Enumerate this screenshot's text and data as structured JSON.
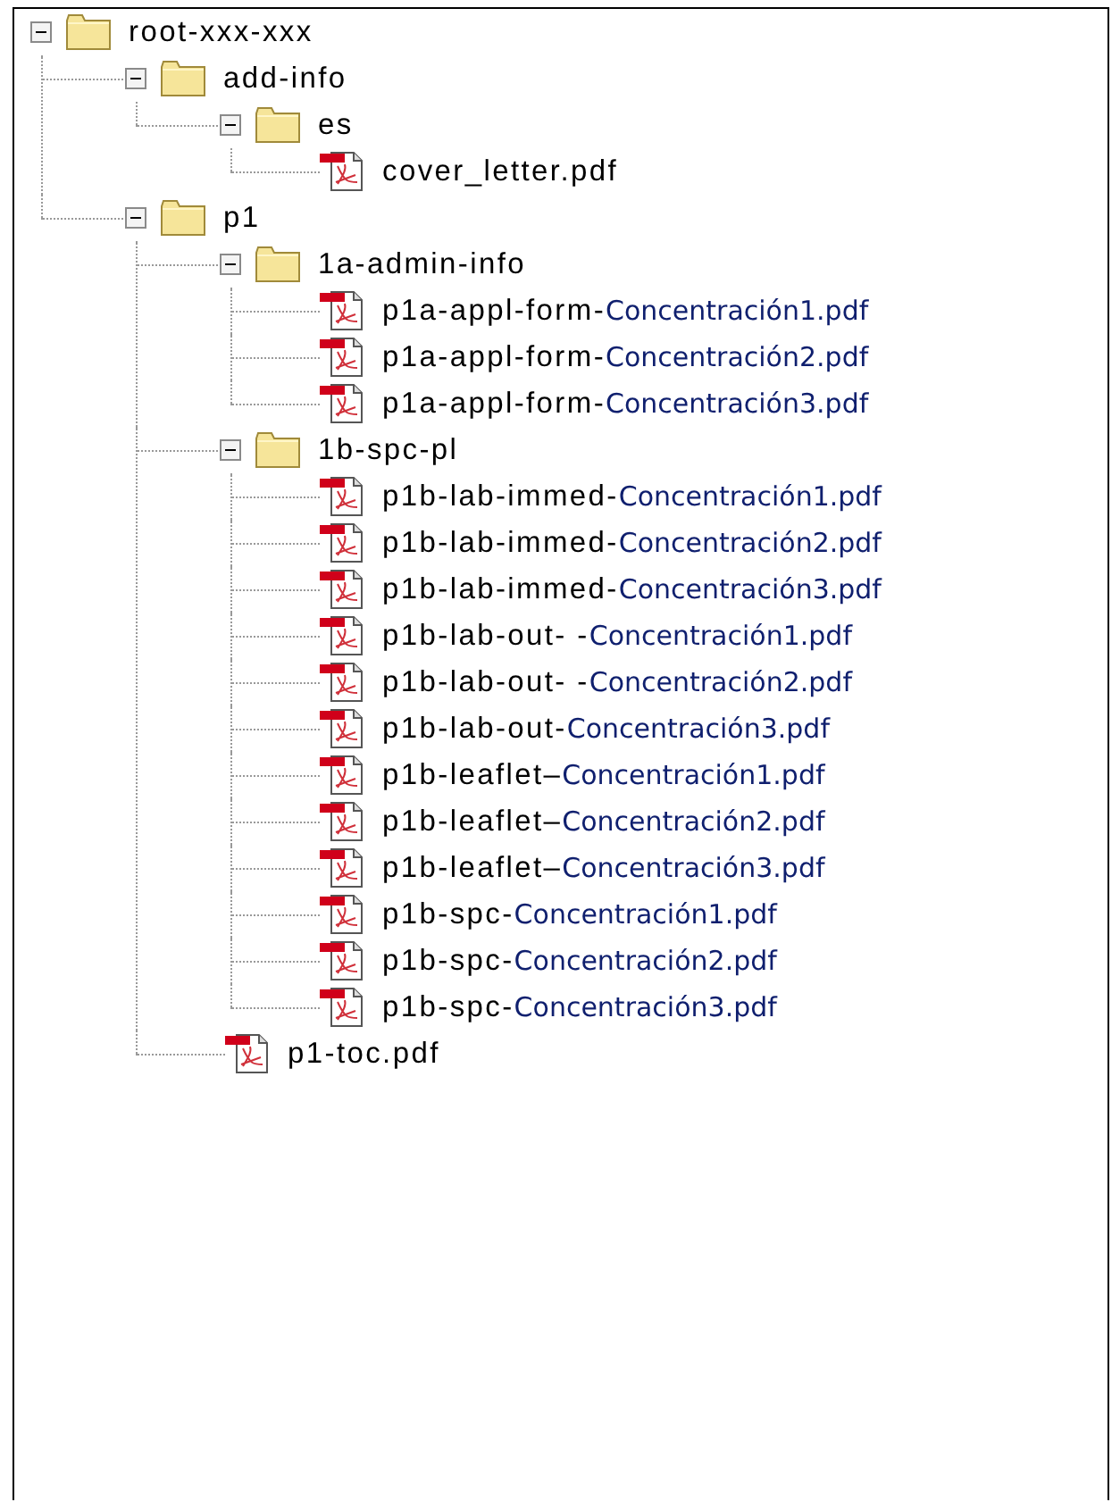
{
  "tree": [
    {
      "kind": "folder",
      "label": "root-xxx-xxx",
      "expanded": true,
      "children": [
        {
          "kind": "folder",
          "label": "add-info",
          "expanded": true,
          "children": [
            {
              "kind": "folder",
              "label": "es",
              "expanded": true,
              "children": [
                {
                  "kind": "file",
                  "label": "cover_letter.pdf"
                }
              ]
            }
          ]
        },
        {
          "kind": "folder",
          "label": "p1",
          "expanded": true,
          "children": [
            {
              "kind": "folder",
              "label": "1a-admin-info",
              "expanded": true,
              "children": [
                {
                  "kind": "file",
                  "label": "p1a-appl-form-",
                  "suffix": "Concentración1.pdf"
                },
                {
                  "kind": "file",
                  "label": "p1a-appl-form-",
                  "suffix": "Concentración2.pdf"
                },
                {
                  "kind": "file",
                  "label": "p1a-appl-form-",
                  "suffix": "Concentración3.pdf"
                }
              ]
            },
            {
              "kind": "folder",
              "label": "1b-spc-pl",
              "expanded": true,
              "children": [
                {
                  "kind": "file",
                  "label": "p1b-lab-immed-",
                  "suffix": "Concentración1.pdf"
                },
                {
                  "kind": "file",
                  "label": "p1b-lab-immed-",
                  "suffix": "Concentración2.pdf"
                },
                {
                  "kind": "file",
                  "label": "p1b-lab-immed-",
                  "suffix": "Concentración3.pdf"
                },
                {
                  "kind": "file",
                  "label": "p1b-lab-out- -",
                  "suffix": "Concentración1.pdf"
                },
                {
                  "kind": "file",
                  "label": "p1b-lab-out- -",
                  "suffix": "Concentración2.pdf"
                },
                {
                  "kind": "file",
                  "label": "p1b-lab-out-",
                  "suffix": "Concentración3.pdf"
                },
                {
                  "kind": "file",
                  "label": "p1b-leaflet–",
                  "suffix": "Concentración1.pdf"
                },
                {
                  "kind": "file",
                  "label": "p1b-leaflet–",
                  "suffix": "Concentración2.pdf"
                },
                {
                  "kind": "file",
                  "label": "p1b-leaflet–",
                  "suffix": "Concentración3.pdf"
                },
                {
                  "kind": "file",
                  "label": "p1b-spc-",
                  "suffix": "Concentración1.pdf"
                },
                {
                  "kind": "file",
                  "label": "p1b-spc-",
                  "suffix": "Concentración2.pdf"
                },
                {
                  "kind": "file",
                  "label": "p1b-spc-",
                  "suffix": "Concentración3.pdf"
                }
              ]
            },
            {
              "kind": "file",
              "label": "p1-toc.pdf"
            }
          ]
        }
      ]
    }
  ]
}
